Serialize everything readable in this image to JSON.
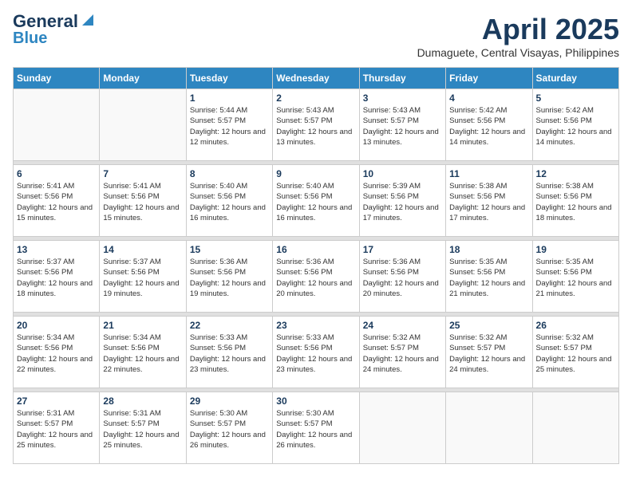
{
  "header": {
    "logo_line1": "General",
    "logo_line2": "Blue",
    "month_title": "April 2025",
    "location": "Dumaguete, Central Visayas, Philippines"
  },
  "weekdays": [
    "Sunday",
    "Monday",
    "Tuesday",
    "Wednesday",
    "Thursday",
    "Friday",
    "Saturday"
  ],
  "weeks": [
    [
      {
        "day": "",
        "info": ""
      },
      {
        "day": "",
        "info": ""
      },
      {
        "day": "1",
        "info": "Sunrise: 5:44 AM\nSunset: 5:57 PM\nDaylight: 12 hours\nand 12 minutes."
      },
      {
        "day": "2",
        "info": "Sunrise: 5:43 AM\nSunset: 5:57 PM\nDaylight: 12 hours\nand 13 minutes."
      },
      {
        "day": "3",
        "info": "Sunrise: 5:43 AM\nSunset: 5:57 PM\nDaylight: 12 hours\nand 13 minutes."
      },
      {
        "day": "4",
        "info": "Sunrise: 5:42 AM\nSunset: 5:56 PM\nDaylight: 12 hours\nand 14 minutes."
      },
      {
        "day": "5",
        "info": "Sunrise: 5:42 AM\nSunset: 5:56 PM\nDaylight: 12 hours\nand 14 minutes."
      }
    ],
    [
      {
        "day": "6",
        "info": "Sunrise: 5:41 AM\nSunset: 5:56 PM\nDaylight: 12 hours\nand 15 minutes."
      },
      {
        "day": "7",
        "info": "Sunrise: 5:41 AM\nSunset: 5:56 PM\nDaylight: 12 hours\nand 15 minutes."
      },
      {
        "day": "8",
        "info": "Sunrise: 5:40 AM\nSunset: 5:56 PM\nDaylight: 12 hours\nand 16 minutes."
      },
      {
        "day": "9",
        "info": "Sunrise: 5:40 AM\nSunset: 5:56 PM\nDaylight: 12 hours\nand 16 minutes."
      },
      {
        "day": "10",
        "info": "Sunrise: 5:39 AM\nSunset: 5:56 PM\nDaylight: 12 hours\nand 17 minutes."
      },
      {
        "day": "11",
        "info": "Sunrise: 5:38 AM\nSunset: 5:56 PM\nDaylight: 12 hours\nand 17 minutes."
      },
      {
        "day": "12",
        "info": "Sunrise: 5:38 AM\nSunset: 5:56 PM\nDaylight: 12 hours\nand 18 minutes."
      }
    ],
    [
      {
        "day": "13",
        "info": "Sunrise: 5:37 AM\nSunset: 5:56 PM\nDaylight: 12 hours\nand 18 minutes."
      },
      {
        "day": "14",
        "info": "Sunrise: 5:37 AM\nSunset: 5:56 PM\nDaylight: 12 hours\nand 19 minutes."
      },
      {
        "day": "15",
        "info": "Sunrise: 5:36 AM\nSunset: 5:56 PM\nDaylight: 12 hours\nand 19 minutes."
      },
      {
        "day": "16",
        "info": "Sunrise: 5:36 AM\nSunset: 5:56 PM\nDaylight: 12 hours\nand 20 minutes."
      },
      {
        "day": "17",
        "info": "Sunrise: 5:36 AM\nSunset: 5:56 PM\nDaylight: 12 hours\nand 20 minutes."
      },
      {
        "day": "18",
        "info": "Sunrise: 5:35 AM\nSunset: 5:56 PM\nDaylight: 12 hours\nand 21 minutes."
      },
      {
        "day": "19",
        "info": "Sunrise: 5:35 AM\nSunset: 5:56 PM\nDaylight: 12 hours\nand 21 minutes."
      }
    ],
    [
      {
        "day": "20",
        "info": "Sunrise: 5:34 AM\nSunset: 5:56 PM\nDaylight: 12 hours\nand 22 minutes."
      },
      {
        "day": "21",
        "info": "Sunrise: 5:34 AM\nSunset: 5:56 PM\nDaylight: 12 hours\nand 22 minutes."
      },
      {
        "day": "22",
        "info": "Sunrise: 5:33 AM\nSunset: 5:56 PM\nDaylight: 12 hours\nand 23 minutes."
      },
      {
        "day": "23",
        "info": "Sunrise: 5:33 AM\nSunset: 5:56 PM\nDaylight: 12 hours\nand 23 minutes."
      },
      {
        "day": "24",
        "info": "Sunrise: 5:32 AM\nSunset: 5:57 PM\nDaylight: 12 hours\nand 24 minutes."
      },
      {
        "day": "25",
        "info": "Sunrise: 5:32 AM\nSunset: 5:57 PM\nDaylight: 12 hours\nand 24 minutes."
      },
      {
        "day": "26",
        "info": "Sunrise: 5:32 AM\nSunset: 5:57 PM\nDaylight: 12 hours\nand 25 minutes."
      }
    ],
    [
      {
        "day": "27",
        "info": "Sunrise: 5:31 AM\nSunset: 5:57 PM\nDaylight: 12 hours\nand 25 minutes."
      },
      {
        "day": "28",
        "info": "Sunrise: 5:31 AM\nSunset: 5:57 PM\nDaylight: 12 hours\nand 25 minutes."
      },
      {
        "day": "29",
        "info": "Sunrise: 5:30 AM\nSunset: 5:57 PM\nDaylight: 12 hours\nand 26 minutes."
      },
      {
        "day": "30",
        "info": "Sunrise: 5:30 AM\nSunset: 5:57 PM\nDaylight: 12 hours\nand 26 minutes."
      },
      {
        "day": "",
        "info": ""
      },
      {
        "day": "",
        "info": ""
      },
      {
        "day": "",
        "info": ""
      }
    ]
  ]
}
